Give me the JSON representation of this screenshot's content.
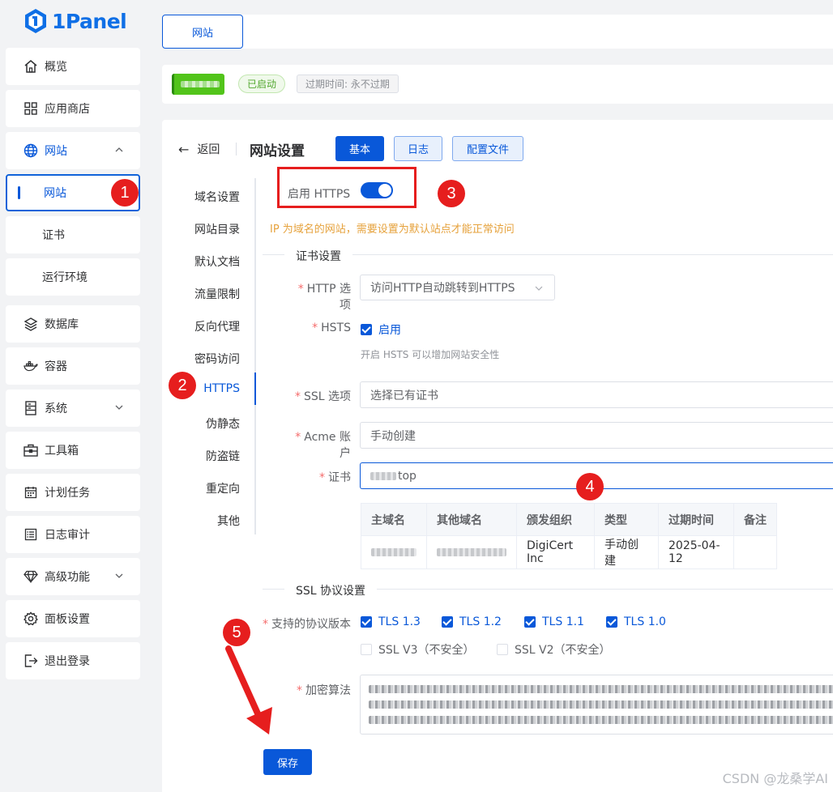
{
  "app": {
    "logo_text": "1Panel"
  },
  "sidebar": {
    "items": [
      {
        "label": "概览",
        "icon": "home-icon"
      },
      {
        "label": "应用商店",
        "icon": "grid-icon"
      },
      {
        "label": "网站",
        "icon": "globe-icon",
        "expanded": true
      },
      {
        "label": "网站",
        "active": true
      },
      {
        "label": "证书"
      },
      {
        "label": "运行环境"
      },
      {
        "label": "数据库",
        "icon": "layers-icon"
      },
      {
        "label": "容器",
        "icon": "docker-icon"
      },
      {
        "label": "系统",
        "icon": "server-icon"
      },
      {
        "label": "工具箱",
        "icon": "toolbox-icon"
      },
      {
        "label": "计划任务",
        "icon": "calendar-icon"
      },
      {
        "label": "日志审计",
        "icon": "log-icon"
      },
      {
        "label": "高级功能",
        "icon": "diamond-icon"
      },
      {
        "label": "面板设置",
        "icon": "gear-icon"
      },
      {
        "label": "退出登录",
        "icon": "logout-icon"
      }
    ]
  },
  "topbar": {
    "tab_label": "网站"
  },
  "site": {
    "status": "已启动",
    "expiry": "过期时间: 永不过期"
  },
  "header": {
    "back": "返回",
    "title": "网站设置",
    "tabs": [
      "基本",
      "日志",
      "配置文件"
    ]
  },
  "menu": [
    "域名设置",
    "网站目录",
    "默认文档",
    "流量限制",
    "反向代理",
    "密码访问",
    "HTTPS",
    "伪静态",
    "防盗链",
    "重定向",
    "其他"
  ],
  "https": {
    "enable_label": "启用 HTTPS",
    "enabled": true,
    "warning": "IP 为域名的网站，需要设置为默认站点才能正常访问",
    "cert_section": "证书设置",
    "http_option_label": "HTTP 选项",
    "http_option_value": "访问HTTP自动跳转到HTTPS",
    "hsts_label": "HSTS",
    "hsts_checkbox": "启用",
    "hsts_hint": "开启 HSTS 可以增加网站安全性",
    "ssl_option_label": "SSL 选项",
    "ssl_option_value": "选择已有证书",
    "acme_label": "Acme 账户",
    "acme_value": "手动创建",
    "cert_label": "证书",
    "cert_value_suffix": "top",
    "table": {
      "headers": [
        "主域名",
        "其他域名",
        "颁发组织",
        "类型",
        "过期时间",
        "备注"
      ],
      "row": {
        "issuer": "DigiCert Inc",
        "type": "手动创建",
        "expire": "2025-04-12"
      }
    },
    "ssl_protocol_section": "SSL 协议设置",
    "protocol_label": "支持的协议版本",
    "protocols": [
      {
        "name": "TLS 1.3",
        "checked": true
      },
      {
        "name": "TLS 1.2",
        "checked": true
      },
      {
        "name": "TLS 1.1",
        "checked": true
      },
      {
        "name": "TLS 1.0",
        "checked": true
      },
      {
        "name": "SSL V3（不安全）",
        "checked": false
      },
      {
        "name": "SSL V2（不安全）",
        "checked": false
      }
    ],
    "cipher_label": "加密算法",
    "save": "保存"
  },
  "annotations": [
    "1",
    "2",
    "3",
    "4",
    "5"
  ],
  "watermark": "CSDN @龙桑学AI",
  "colors": {
    "primary": "#0958d9",
    "annotation": "#e61e1e",
    "success": "#52c41a"
  }
}
